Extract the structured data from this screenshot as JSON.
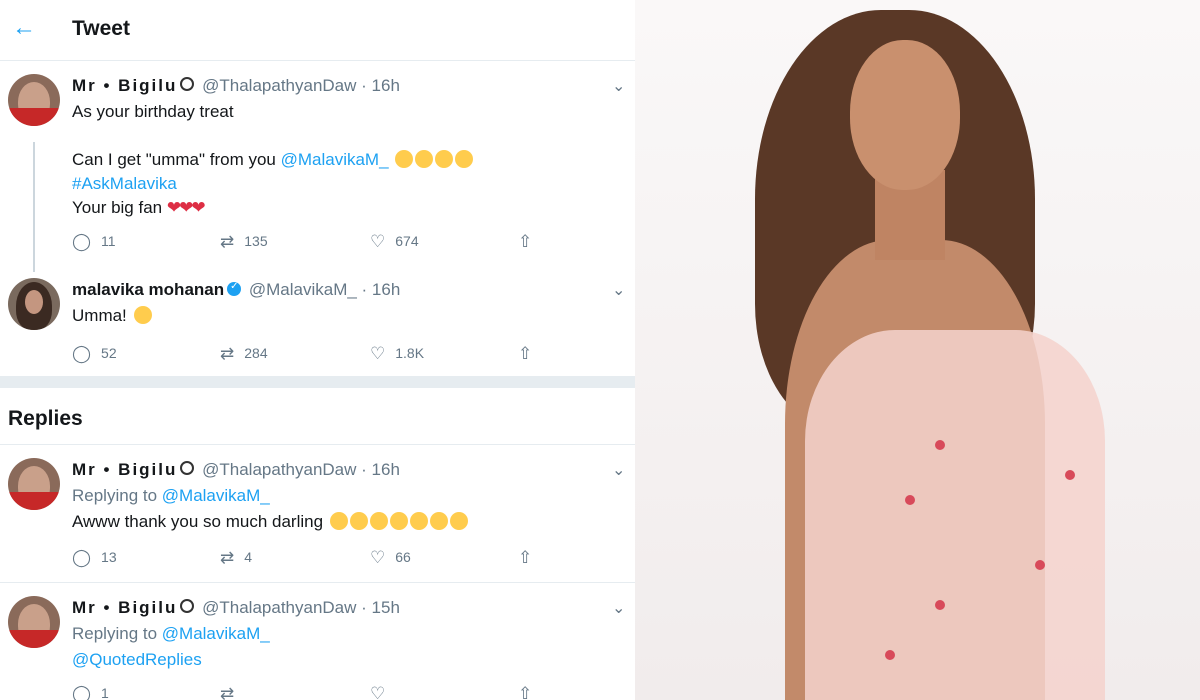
{
  "header": {
    "back_icon": "←",
    "title": "Tweet"
  },
  "icons": {
    "reply": "◯",
    "retweet": "⇄",
    "like": "♡",
    "share": "⇧",
    "caret": "⌄"
  },
  "tweets": [
    {
      "name": "Mr • Bigilu",
      "handle": "@ThalapathyanDaw",
      "time": "· 16h",
      "line1": "As your birthday treat",
      "line2_prefix": "Can I get \"umma\" from you ",
      "line2_mention": "@MalavikaM_",
      "line3": "#AskMalavika",
      "line4": "Your big fan ",
      "hearts": "❤❤❤",
      "replies": "11",
      "retweets": "135",
      "likes": "674"
    },
    {
      "name": "malavika mohanan",
      "handle": "@MalavikaM_",
      "time": "· 16h",
      "text": "Umma! ",
      "replies": "52",
      "retweets": "284",
      "likes": "1.8K"
    }
  ],
  "replies_heading": "Replies",
  "replies": [
    {
      "name": "Mr • Bigilu",
      "handle": "@ThalapathyanDaw",
      "time": "· 16h",
      "replying_to": "Replying to ",
      "replying_handle": "@MalavikaM_",
      "text": "Awww thank you so much darling ",
      "replies": "13",
      "retweets": "4",
      "likes": "66"
    },
    {
      "name": "Mr • Bigilu",
      "handle": "@ThalapathyanDaw",
      "time": "· 15h",
      "replying_to": "Replying to ",
      "replying_handle": "@MalavikaM_",
      "text": "@QuotedReplies",
      "replies": "1"
    }
  ],
  "colors": {
    "accent": "#1da1f2",
    "text": "#14171a",
    "muted": "#657786",
    "heart": "#dd2e44"
  }
}
